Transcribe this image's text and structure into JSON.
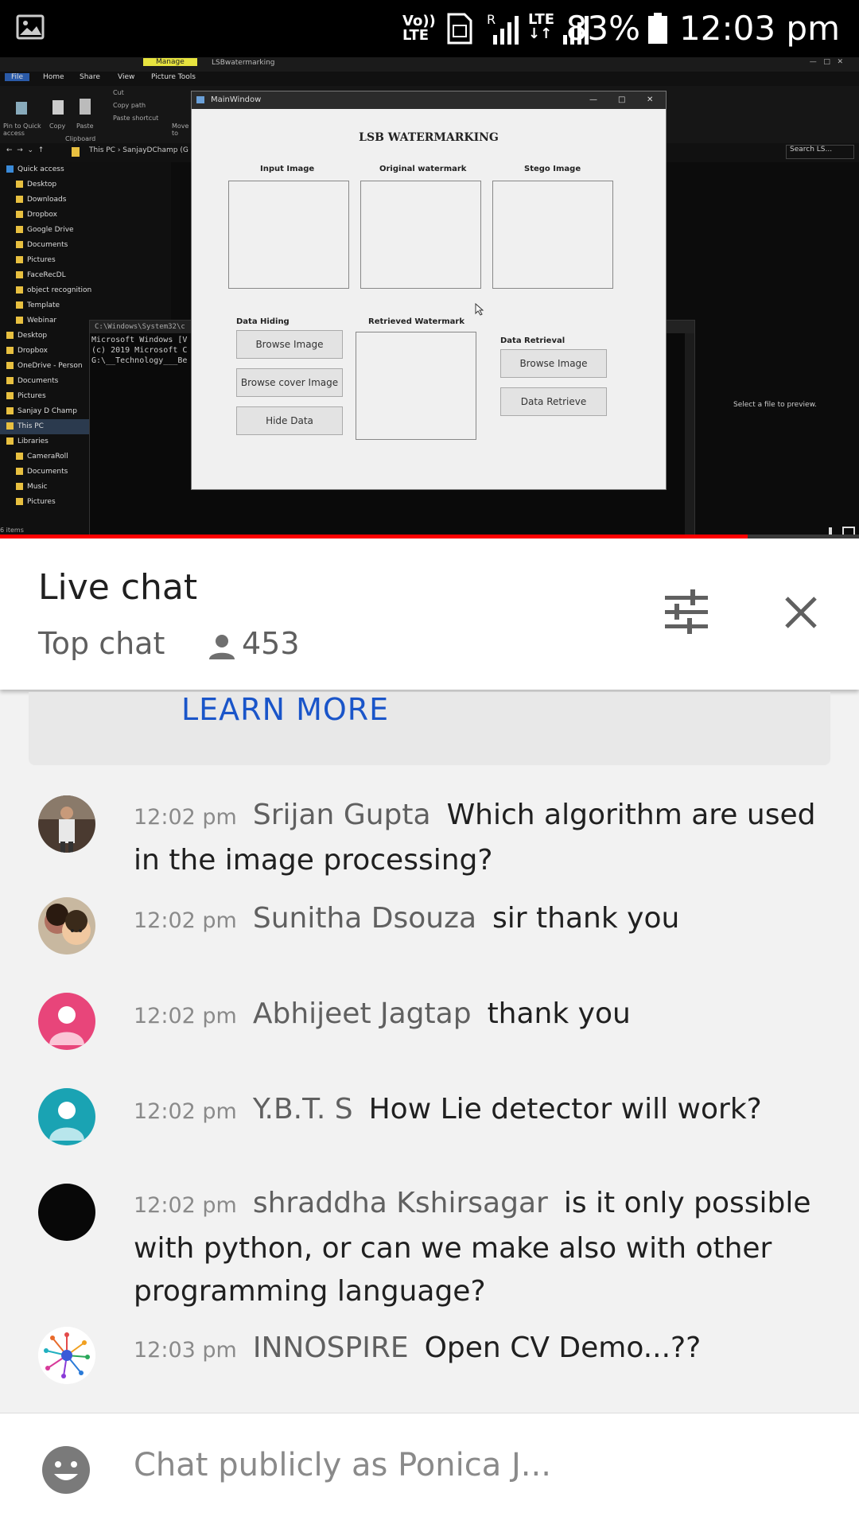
{
  "status_bar": {
    "net1": "Vo))\nLTE",
    "net2": "R",
    "net3": "LTE",
    "battery": "83%",
    "time": "12:03 pm"
  },
  "video": {
    "explorer": {
      "ribbon_tabs": [
        "File",
        "Home",
        "Share",
        "View",
        "Picture Tools"
      ],
      "manage_tab": "Manage",
      "folder_title": "LSBwatermarking",
      "tools": [
        "Pin to Quick access",
        "Copy",
        "Paste",
        "Cut",
        "Copy path",
        "Paste shortcut",
        "Move to"
      ],
      "clipboard": "Clipboard",
      "address": "This PC  ›  SanjayDChamp (G",
      "search": "Search LS...",
      "sidebar": [
        "Quick access",
        "Desktop",
        "Downloads",
        "Dropbox",
        "Google Drive",
        "Documents",
        "Pictures",
        "FaceRecDL",
        "object recognition",
        "Template",
        "Webinar",
        "Desktop",
        "Dropbox",
        "OneDrive - Person",
        "Documents",
        "Pictures",
        "Sanjay D Champ",
        "This PC",
        "Libraries",
        "CameraRoll",
        "Documents",
        "Music",
        "Pictures"
      ],
      "items_count": "6 items",
      "preview": "Select a file to preview."
    },
    "cmd": {
      "title": "C:\\Windows\\System32\\c",
      "lines": [
        "Microsoft Windows [V",
        "(c) 2019 Microsoft C",
        "",
        "G:\\__Technology___Be"
      ]
    },
    "main_window": {
      "title": "MainWindow",
      "heading": "LSB WATERMARKING",
      "labels": {
        "input_image": "Input Image",
        "original_watermark": "Original watermark",
        "stego_image": "Stego Image",
        "data_hiding": "Data Hiding",
        "retrieved_watermark": "Retrieved Watermark",
        "data_retrieval": "Data Retrieval"
      },
      "buttons": {
        "browse_image": "Browse Image",
        "browse_cover": "Browse cover Image",
        "hide_data": "Hide Data",
        "browse_image_2": "Browse Image",
        "data_retrieve": "Data Retrieve"
      }
    },
    "progress": 0.87
  },
  "chat_header": {
    "title": "Live chat",
    "mode": "Top chat",
    "viewers": "453"
  },
  "learn_more": "LEARN MORE",
  "messages": [
    {
      "time": "12:02 pm",
      "author": "Srijan Gupta",
      "text": "Which algorithm are used in the image processing?",
      "avatar": "photo-man"
    },
    {
      "time": "12:02 pm",
      "author": "Sunitha Dsouza",
      "text": "sir thank you",
      "avatar": "photo-family"
    },
    {
      "time": "12:02 pm",
      "author": "Abhijeet Jagtap",
      "text": "thank you",
      "avatar": "default-pink",
      "color": "#e8457a"
    },
    {
      "time": "12:02 pm",
      "author": "Y.B.T. S",
      "text": "How Lie detector will work?",
      "avatar": "default-teal",
      "color": "#1aa3b3"
    },
    {
      "time": "12:02 pm",
      "author": "shraddha Kshirsagar",
      "text": "is it only possible with python, or can we make also with other programming language?",
      "avatar": "black",
      "color": "#080808"
    },
    {
      "time": "12:03 pm",
      "author": "INNOSPIRE",
      "text": "Open CV Demo...??",
      "avatar": "logo-innospire"
    }
  ],
  "input": {
    "placeholder": "Chat publicly as Ponica J..."
  }
}
